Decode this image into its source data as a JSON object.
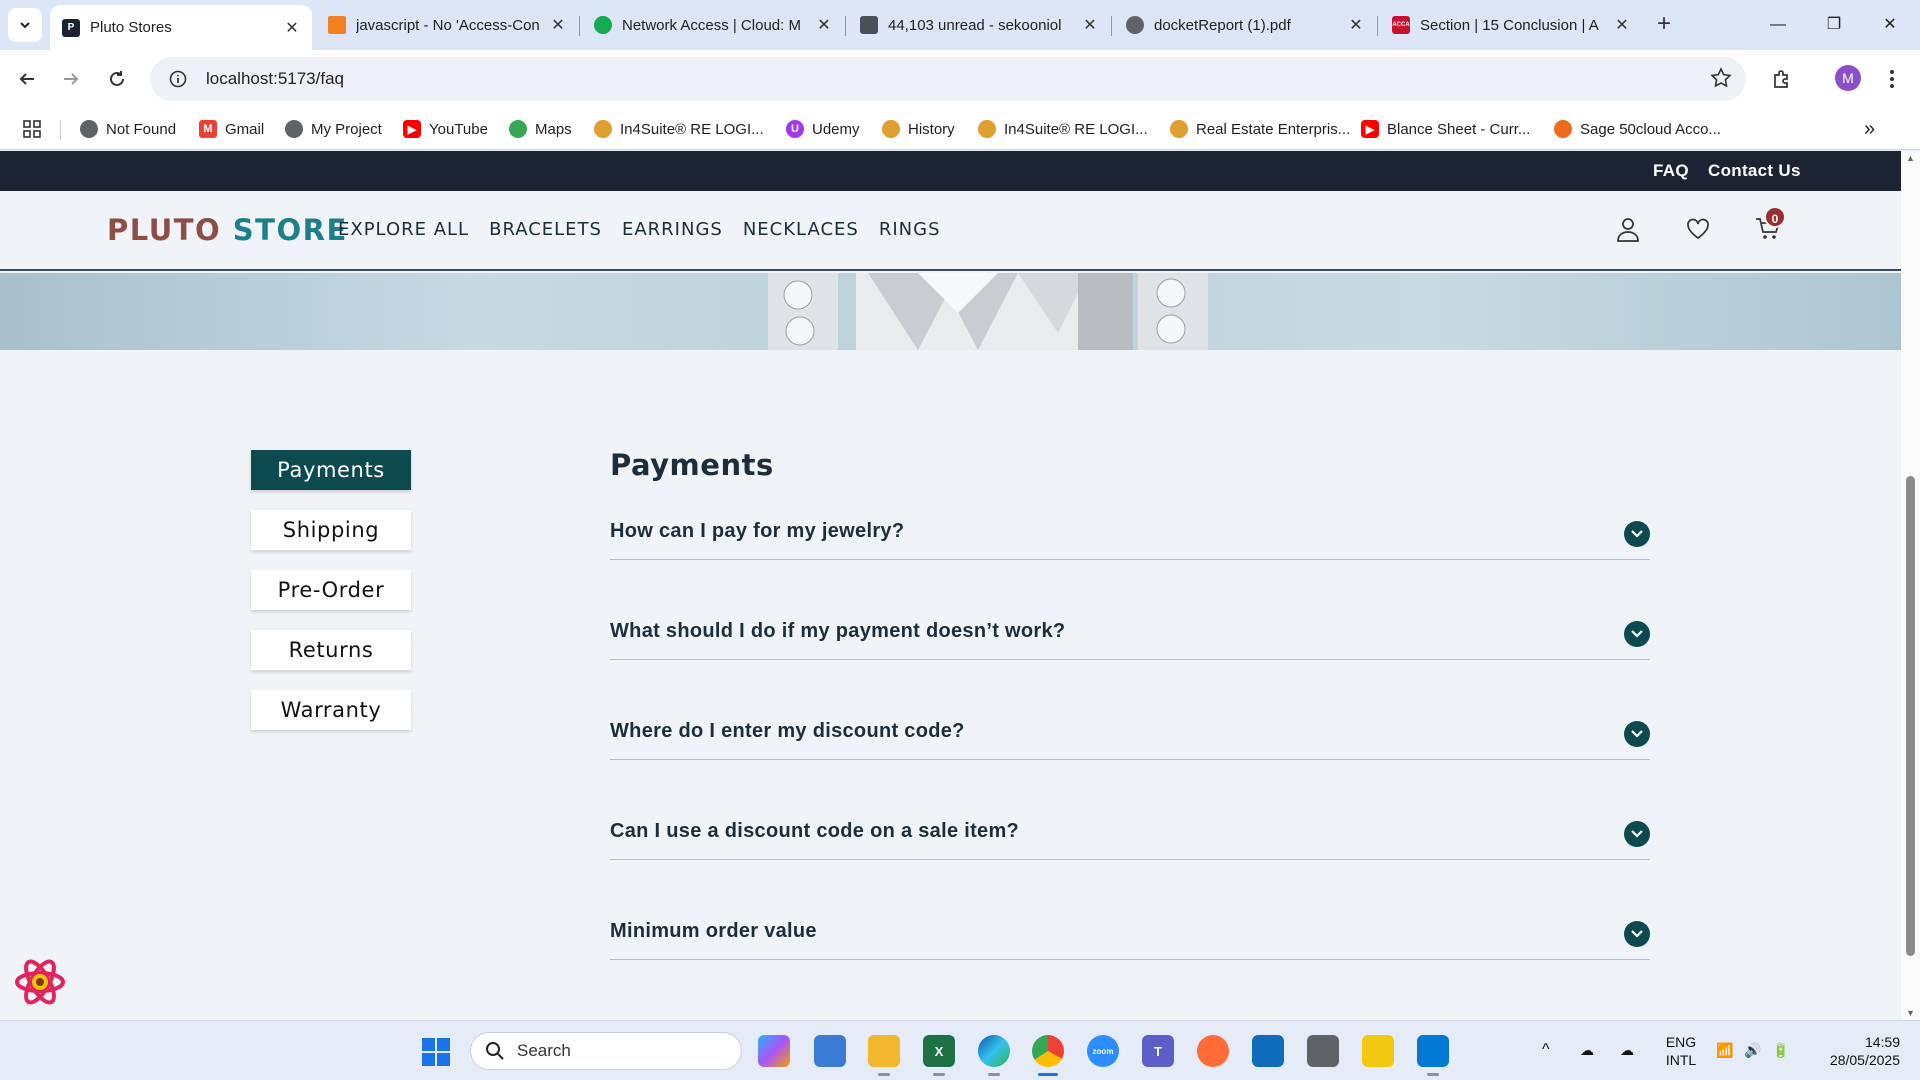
{
  "browser": {
    "tabs": [
      {
        "title": "Pluto Stores",
        "active": true,
        "icon": "P"
      },
      {
        "title": "javascript - No 'Access-Con",
        "active": false,
        "icon": "stack"
      },
      {
        "title": "Network Access | Cloud: M",
        "active": false,
        "icon": "leaf"
      },
      {
        "title": "44,103 unread - sekooniol",
        "active": false,
        "icon": "mail"
      },
      {
        "title": "docketReport (1).pdf",
        "active": false,
        "icon": "globe"
      },
      {
        "title": "Section | 15 Conclusion | A",
        "active": false,
        "icon": "ACCA"
      }
    ],
    "url": "localhost:5173/faq",
    "profile_initial": "M",
    "bookmarks": [
      "Not Found",
      "Gmail",
      "My Project",
      "YouTube",
      "Maps",
      "In4Suite® RE LOGI...",
      "Udemy",
      "History",
      "In4Suite® RE LOGI...",
      "Real Estate Enterpris...",
      "Blance Sheet - Curr...",
      "Sage 50cloud Acco..."
    ]
  },
  "site": {
    "top_links": {
      "faq": "FAQ",
      "contact": "Contact Us"
    },
    "logo": {
      "part1": "PLUTO",
      "part2": "STORE"
    },
    "nav": [
      "EXPLORE ALL",
      "BRACELETS",
      "EARRINGS",
      "NECKLACES",
      "RINGS"
    ],
    "cart_count": "0",
    "colors": {
      "dark": "#1c2434",
      "accent": "#0d4a4f",
      "logo_red": "#8e4e46",
      "logo_teal": "#1d7f8c"
    }
  },
  "faq": {
    "categories": [
      "Payments",
      "Shipping",
      "Pre-Order",
      "Returns",
      "Warranty"
    ],
    "active_category": "Payments",
    "heading": "Payments",
    "questions": [
      "How can I pay for my jewelry?",
      "What should I do if my payment doesn’t work?",
      "Where do I enter my discount code?",
      "Can I use a discount code on a sale item?",
      "Minimum order value"
    ]
  },
  "taskbar": {
    "search_placeholder": "Search",
    "language": "ENG",
    "keyboard": "INTL",
    "time": "14:59",
    "date": "28/05/2025"
  }
}
